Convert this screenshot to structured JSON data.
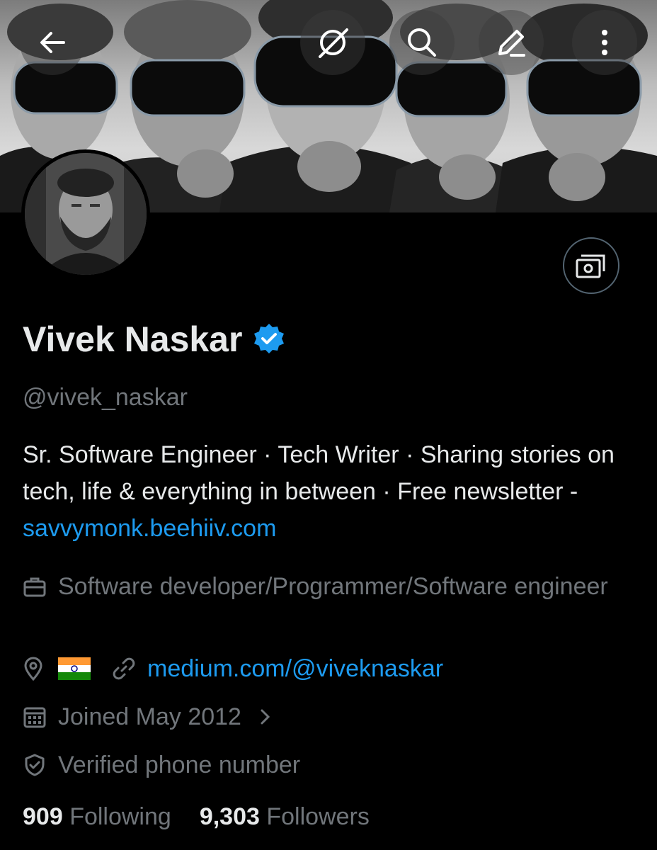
{
  "header": {
    "back_icon": "arrow-left-icon",
    "grok_icon": "grok-icon",
    "search_icon": "search-icon",
    "edit_icon": "edit-icon",
    "more_icon": "more-vertical-icon"
  },
  "profile": {
    "name": "Vivek Naskar",
    "handle": "@vivek_naskar",
    "verified_color": "#1d9bf0",
    "bio_text": "Sr. Software Engineer · Tech Writer · Sharing stories on tech, life & everything in between · Free newsletter - ",
    "bio_link": "savvymonk.beehiiv.com",
    "profession": "Software developer/Programmer/Software engineer",
    "location_flag": "🇮🇳",
    "website": "medium.com/@viveknaskar",
    "joined": "Joined May 2012",
    "verified_phone": "Verified phone number",
    "following_count": "909",
    "following_label": "Following",
    "followers_count": "9,303",
    "followers_label": "Followers"
  },
  "colors": {
    "background": "#000000",
    "text_primary": "#e7e9ea",
    "text_secondary": "#71767b",
    "link": "#1d9bf0"
  }
}
